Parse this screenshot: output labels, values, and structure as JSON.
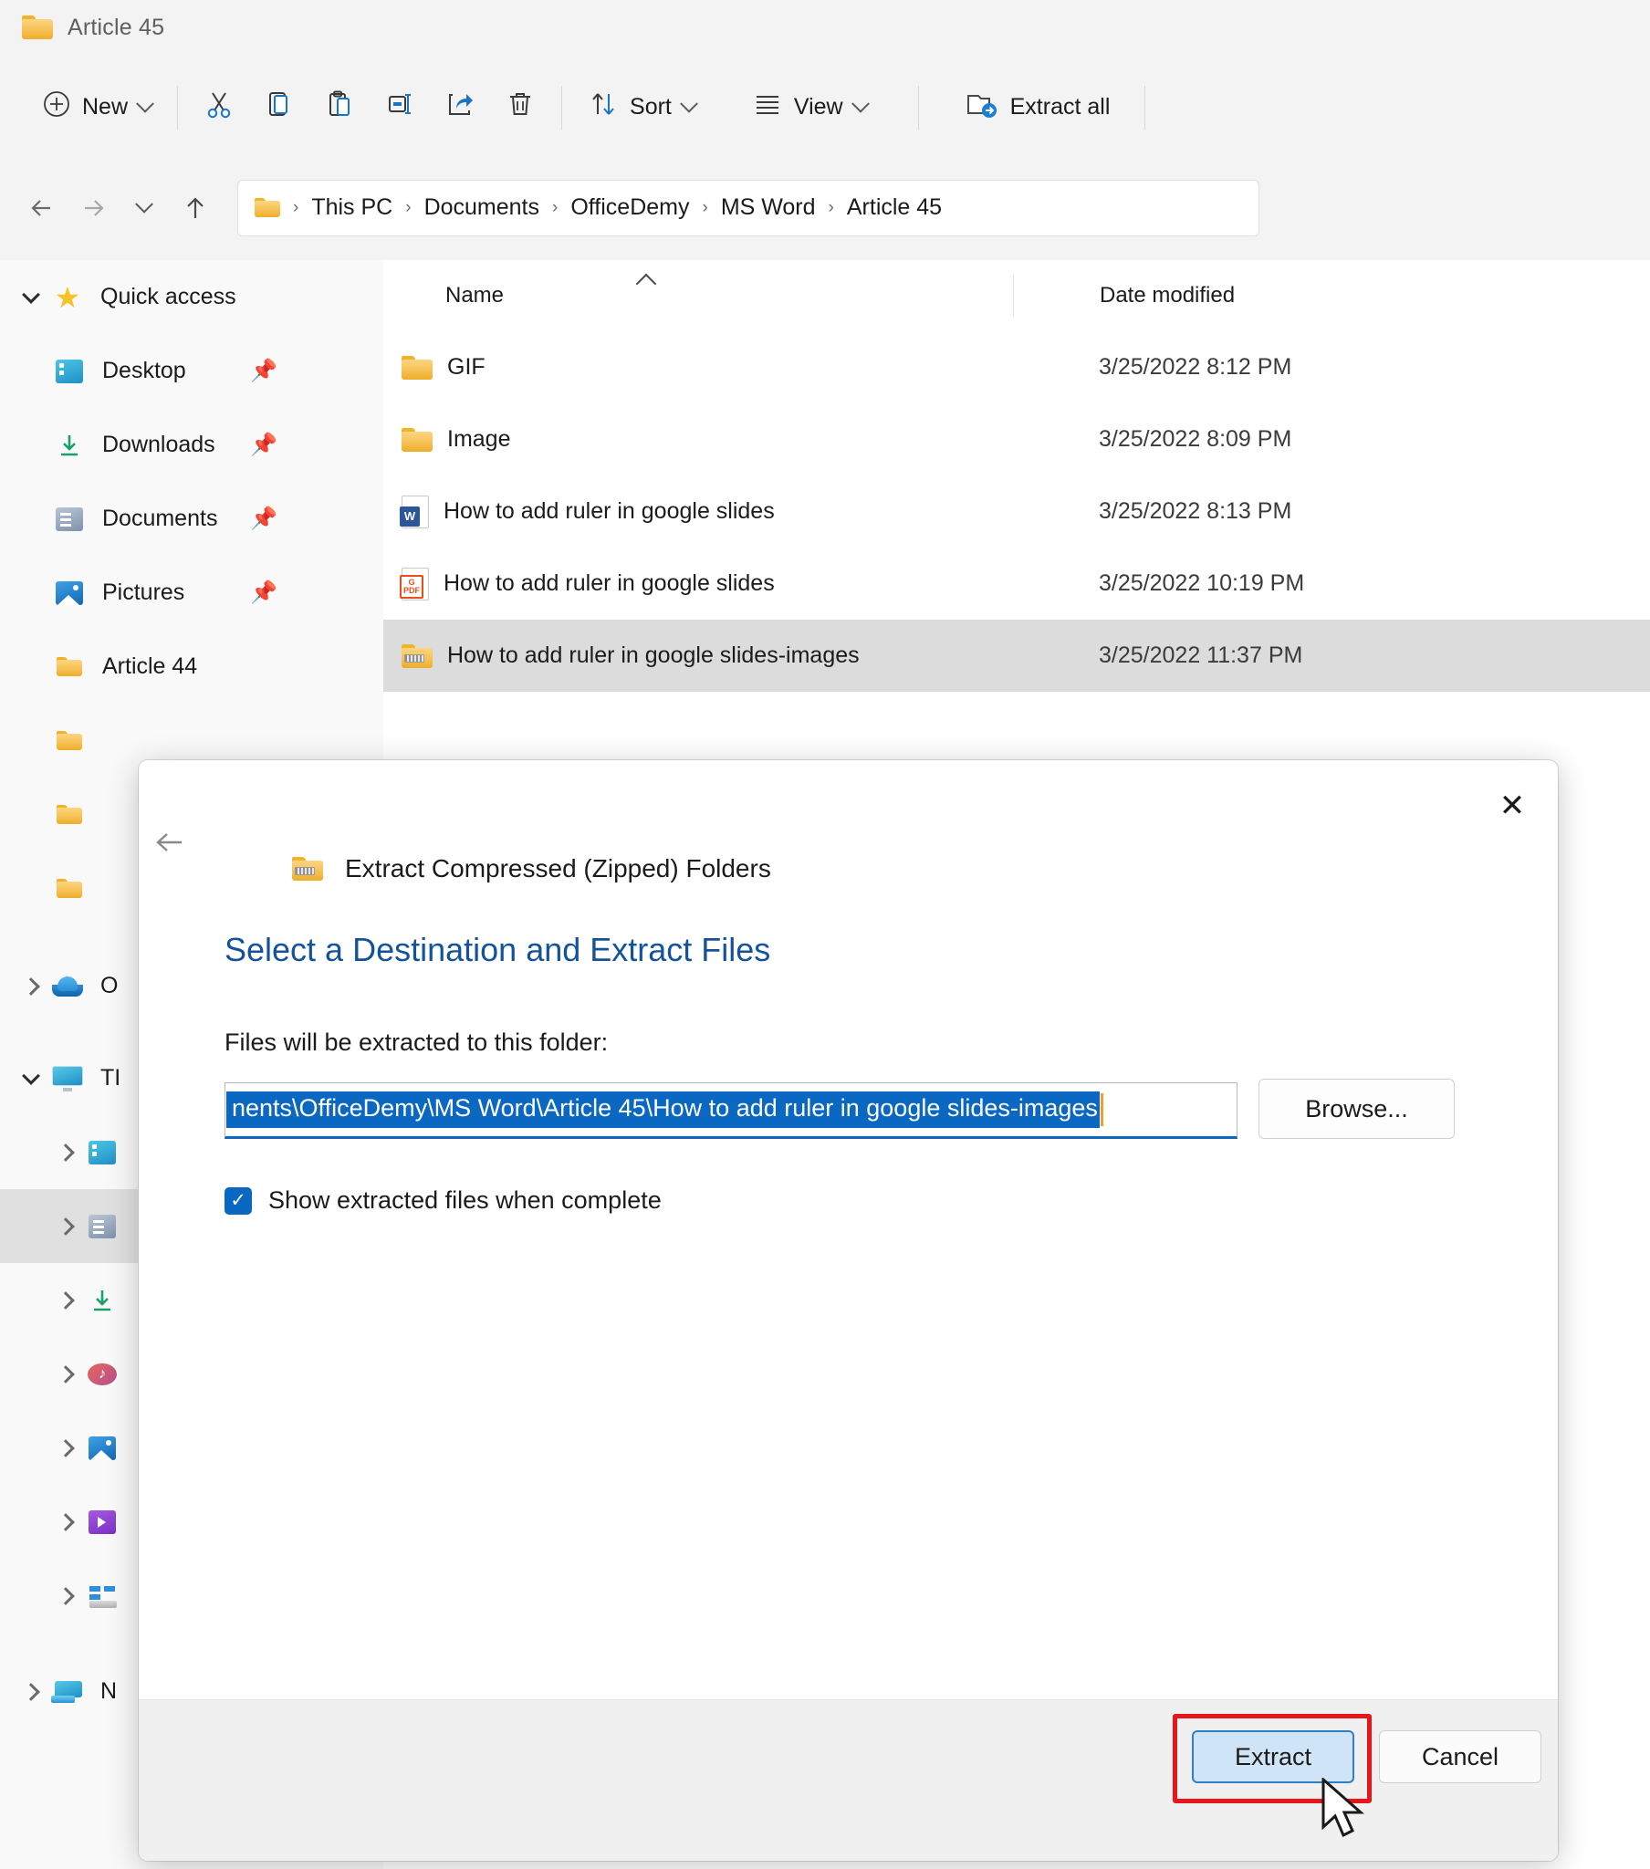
{
  "window": {
    "title": "Article 45",
    "folder_icon": "folder-icon"
  },
  "toolbar": {
    "new_label": "New",
    "sort_label": "Sort",
    "view_label": "View",
    "extract_all_label": "Extract all",
    "icons": {
      "new": "plus-circle-icon",
      "cut": "scissors-icon",
      "copy": "copy-icon",
      "paste": "paste-icon",
      "rename": "rename-icon",
      "share": "share-icon",
      "delete": "trash-icon",
      "sort": "sort-arrows-icon",
      "view": "view-lines-icon",
      "extract_all": "extract-folder-icon",
      "overflow": "chevron-down-icon"
    }
  },
  "address": {
    "back": "back-arrow-icon",
    "forward": "forward-arrow-icon",
    "recent": "chevron-down-icon",
    "up": "up-arrow-icon",
    "crumbs": [
      "This PC",
      "Documents",
      "OfficeDemy",
      "MS Word",
      "Article 45"
    ],
    "separator": "›"
  },
  "sidebar": {
    "items": [
      {
        "label": "Quick access",
        "icon": "star-icon",
        "expander": "down",
        "indent": 0,
        "pinned": false,
        "selected": false
      },
      {
        "label": "Desktop",
        "icon": "desktop-icon",
        "expander": "none",
        "indent": 1,
        "pinned": true,
        "selected": false
      },
      {
        "label": "Downloads",
        "icon": "downloads-icon",
        "expander": "none",
        "indent": 1,
        "pinned": true,
        "selected": false
      },
      {
        "label": "Documents",
        "icon": "documents-icon",
        "expander": "none",
        "indent": 1,
        "pinned": true,
        "selected": false
      },
      {
        "label": "Pictures",
        "icon": "pictures-icon",
        "expander": "none",
        "indent": 1,
        "pinned": true,
        "selected": false
      },
      {
        "label": "Article 44",
        "icon": "folder-icon",
        "expander": "none",
        "indent": 1,
        "pinned": false,
        "selected": false
      },
      {
        "label": "",
        "icon": "folder-icon",
        "expander": "none",
        "indent": 1,
        "pinned": false,
        "selected": false
      },
      {
        "label": "",
        "icon": "folder-icon",
        "expander": "none",
        "indent": 1,
        "pinned": false,
        "selected": false
      },
      {
        "label": "",
        "icon": "folder-icon",
        "expander": "none",
        "indent": 1,
        "pinned": false,
        "selected": false
      },
      {
        "label": "O",
        "icon": "onedrive-cloud-icon",
        "expander": "right",
        "indent": 0,
        "pinned": false,
        "selected": false
      },
      {
        "label": "TI",
        "icon": "this-pc-icon",
        "expander": "down",
        "indent": 0,
        "pinned": false,
        "selected": false
      },
      {
        "label": "",
        "icon": "desktop-icon",
        "expander": "right",
        "indent": 1,
        "pinned": false,
        "selected": false
      },
      {
        "label": "",
        "icon": "documents-icon",
        "expander": "right",
        "indent": 1,
        "pinned": false,
        "selected": true
      },
      {
        "label": "",
        "icon": "downloads-icon",
        "expander": "right",
        "indent": 1,
        "pinned": false,
        "selected": false
      },
      {
        "label": "",
        "icon": "music-icon",
        "expander": "right",
        "indent": 1,
        "pinned": false,
        "selected": false
      },
      {
        "label": "",
        "icon": "pictures-icon",
        "expander": "right",
        "indent": 1,
        "pinned": false,
        "selected": false
      },
      {
        "label": "",
        "icon": "videos-icon",
        "expander": "right",
        "indent": 1,
        "pinned": false,
        "selected": false
      },
      {
        "label": "",
        "icon": "local-disk-icon",
        "expander": "right",
        "indent": 1,
        "pinned": false,
        "selected": false
      },
      {
        "label": "N",
        "icon": "network-icon",
        "expander": "right",
        "indent": 0,
        "pinned": false,
        "selected": false
      }
    ]
  },
  "filelist": {
    "columns": {
      "name": "Name",
      "date_modified": "Date modified"
    },
    "sort_indicator": "ascending-caret-icon",
    "rows": [
      {
        "name": "GIF",
        "date": "3/25/2022 8:12 PM",
        "icon": "folder-icon",
        "selected": false
      },
      {
        "name": "Image",
        "date": "3/25/2022 8:09 PM",
        "icon": "folder-icon",
        "selected": false
      },
      {
        "name": "How to add ruler in google slides",
        "date": "3/25/2022 8:13 PM",
        "icon": "word-document-icon",
        "selected": false
      },
      {
        "name": "How to add ruler in google slides",
        "date": "3/25/2022 10:19 PM",
        "icon": "pdf-document-icon",
        "selected": false
      },
      {
        "name": "How to add ruler in google slides-images",
        "date": "3/25/2022 11:37 PM",
        "icon": "zipped-folder-icon",
        "selected": true
      }
    ]
  },
  "dialog": {
    "close_icon": "close-icon",
    "back_icon": "back-arrow-icon",
    "header_icon": "zipped-folder-icon",
    "header_title": "Extract Compressed (Zipped) Folders",
    "heading": "Select a Destination and Extract Files",
    "subheading": "Files will be extracted to this folder:",
    "path_value": "nents\\OfficeDemy\\MS Word\\Article 45\\How to add ruler in google slides-images",
    "browse_label": "Browse...",
    "checkbox_label": "Show extracted files when complete",
    "checkbox_checked": true,
    "check_glyph": "✓",
    "extract_label": "Extract",
    "cancel_label": "Cancel",
    "highlight_color": "#e8161a",
    "accent_color": "#0a67c2",
    "heading_color": "#14539a"
  }
}
